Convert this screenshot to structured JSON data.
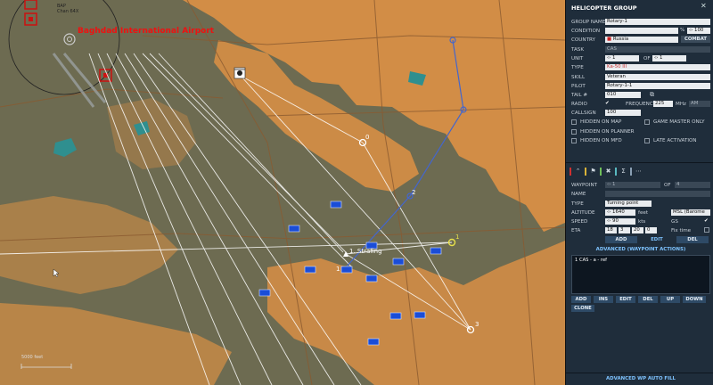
{
  "map": {
    "airport_name": "Baghdad International Airport",
    "airport_code_lines": [
      "BAP",
      "Chan 64X"
    ],
    "scale_label": "5000 feet",
    "labels": {
      "wp0": "0",
      "wp1_strafe": "1. Strafing",
      "wp1_alt": "1",
      "wp2": "2",
      "wp3": "3"
    }
  },
  "panel": {
    "title": "HELICOPTER GROUP",
    "group_name": {
      "label": "GROUP NAME",
      "value": "Rotary-1"
    },
    "condition": {
      "label": "CONDITION",
      "percent": "%",
      "value": "100"
    },
    "country": {
      "label": "COUNTRY",
      "value": "Russia",
      "button": "COMBAT"
    },
    "task": {
      "label": "TASK",
      "value": "CAS"
    },
    "unit": {
      "label": "UNIT",
      "value": "1",
      "of": "OF",
      "total": "1"
    },
    "type": {
      "label": "TYPE",
      "value": "Ka-50 III"
    },
    "skill": {
      "label": "SKILL",
      "value": "Veteran"
    },
    "pilot": {
      "label": "PILOT",
      "value": "Rotary-1-1"
    },
    "tail": {
      "label": "TAIL #",
      "value": "010"
    },
    "radio": {
      "label": "RADIO",
      "freq_label": "FREQUENCY",
      "freq": "225",
      "unit": "MHz",
      "mode": "AM"
    },
    "callsign": {
      "label": "CALLSIGN",
      "value": "100"
    },
    "checks": {
      "hidden_map": "HIDDEN ON MAP",
      "gm_only": "GAME MASTER ONLY",
      "hidden_planner": "HIDDEN ON PLANNER",
      "hidden_mfd": "HIDDEN ON MFD",
      "late_activation": "LATE ACTIVATION"
    },
    "waypoint": {
      "label": "WAYPOINT",
      "value": "1",
      "of": "OF",
      "total": "4",
      "name_label": "NAME",
      "name": "",
      "type_label": "TYPE",
      "type": "Turning point",
      "alt_label": "ALTITUDE",
      "alt": "1640",
      "alt_unit": "feet",
      "alt_ref": "MSL (Barome",
      "speed_label": "SPEED",
      "speed": "90",
      "speed_unit": "kts",
      "gs": "GS",
      "eta_label": "ETA",
      "eta_h": "18",
      "eta_m": "3",
      "eta_s": "20",
      "eta_x": "0",
      "fix_time": "Fix time",
      "add": "ADD",
      "edit": "EDIT",
      "del": "DEL"
    },
    "advanced_actions": "ADVANCED (WAYPOINT ACTIONS)",
    "actions_list": [
      "1 CAS - a - ref"
    ],
    "action_buttons": {
      "add": "ADD",
      "ins": "INS",
      "edit": "EDIT",
      "del": "DEL",
      "up": "UP",
      "down": "DOWN",
      "clone": "CLONE"
    },
    "auto_fill": "ADVANCED WP AUTO FILL"
  },
  "colors": {
    "panel_bg": "#1f2d3b",
    "map_ground": "#6d6b51",
    "urban": "#d28d46",
    "route_white": "#ffffff",
    "route_blue": "#4466cc",
    "unit_blue": "#1a4dd8",
    "accent_link": "#7ec3ff"
  }
}
